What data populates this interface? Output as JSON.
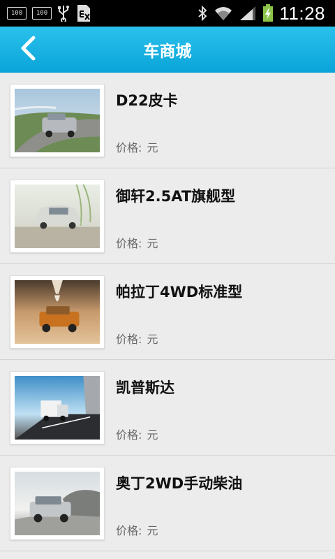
{
  "status_bar": {
    "badge1": "100",
    "badge2": "100",
    "time": "11:28"
  },
  "header": {
    "title": "车商城"
  },
  "price_label": "价格:",
  "items": [
    {
      "name": "D22皮卡",
      "price_value": "",
      "price_unit": "元"
    },
    {
      "name": "御轩2.5AT旗舰型",
      "price_value": "",
      "price_unit": "元"
    },
    {
      "name": "帕拉丁4WD标准型",
      "price_value": "",
      "price_unit": "元"
    },
    {
      "name": "凯普斯达",
      "price_value": "",
      "price_unit": "元"
    },
    {
      "name": "奥丁2WD手动柴油",
      "price_value": "",
      "price_unit": "元"
    }
  ],
  "colors": {
    "header": "#15aee0",
    "background": "#ececec"
  }
}
